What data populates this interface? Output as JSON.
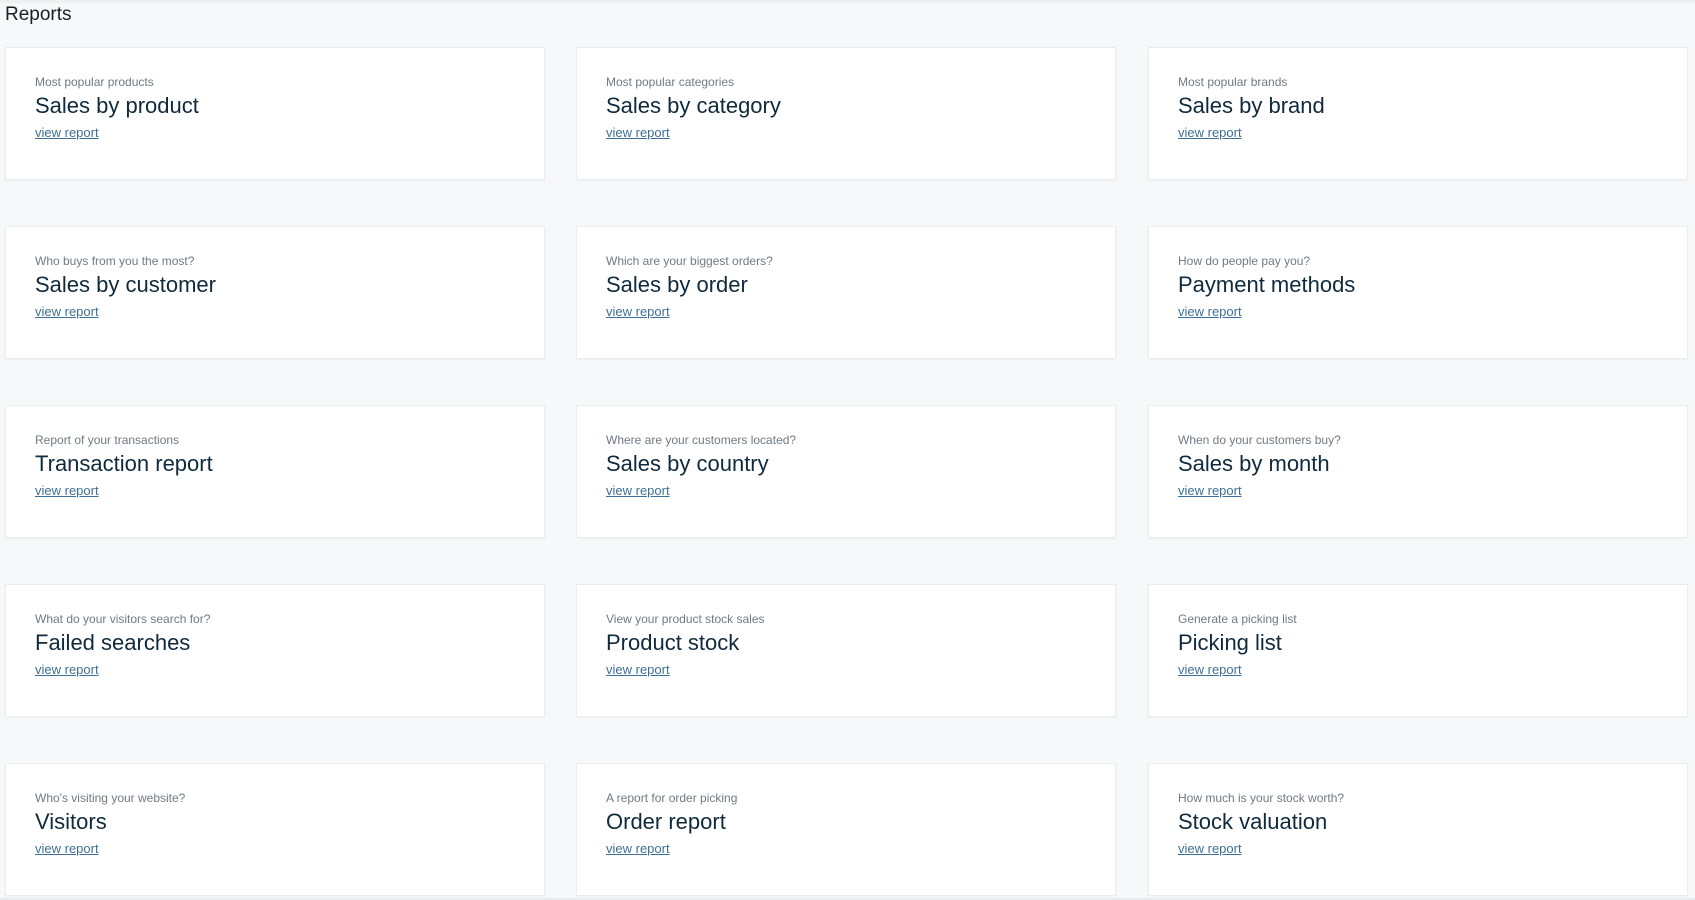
{
  "page": {
    "title": "Reports"
  },
  "cards": [
    {
      "subtitle": "Most popular products",
      "title": "Sales by product",
      "link": "view report"
    },
    {
      "subtitle": "Most popular categories",
      "title": "Sales by category",
      "link": "view report"
    },
    {
      "subtitle": "Most popular brands",
      "title": "Sales by brand",
      "link": "view report"
    },
    {
      "subtitle": "Who buys from you the most?",
      "title": "Sales by customer",
      "link": "view report"
    },
    {
      "subtitle": "Which are your biggest orders?",
      "title": "Sales by order",
      "link": "view report"
    },
    {
      "subtitle": "How do people pay you?",
      "title": "Payment methods",
      "link": "view report"
    },
    {
      "subtitle": "Report of your transactions",
      "title": "Transaction report",
      "link": "view report"
    },
    {
      "subtitle": "Where are your customers located?",
      "title": "Sales by country",
      "link": "view report"
    },
    {
      "subtitle": "When do your customers buy?",
      "title": "Sales by month",
      "link": "view report"
    },
    {
      "subtitle": "What do your visitors search for?",
      "title": "Failed searches",
      "link": "view report"
    },
    {
      "subtitle": "View your product stock sales",
      "title": "Product stock",
      "link": "view report"
    },
    {
      "subtitle": "Generate a picking list",
      "title": "Picking list",
      "link": "view report"
    },
    {
      "subtitle": "Who's visiting your website?",
      "title": "Visitors",
      "link": "view report"
    },
    {
      "subtitle": "A report for order picking",
      "title": "Order report",
      "link": "view report"
    },
    {
      "subtitle": "How much is your stock worth?",
      "title": "Stock valuation",
      "link": "view report"
    }
  ],
  "colors": {
    "background": "#f6f8fa",
    "card": "#ffffff",
    "title": "#0f2a3c",
    "subtitle": "#6f7a85",
    "link": "#3e6f96"
  }
}
